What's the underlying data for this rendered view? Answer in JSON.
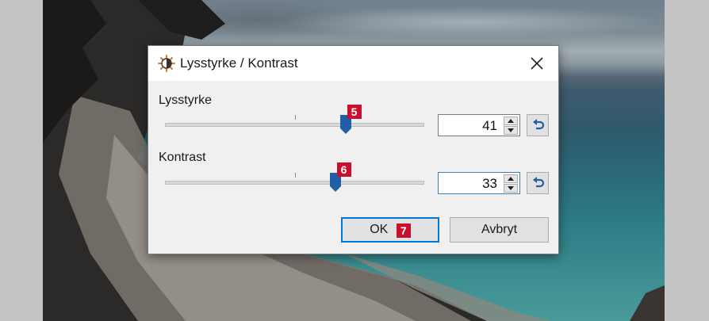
{
  "dialog": {
    "title": "Lysstyrke / Kontrast",
    "icon": "brightness-contrast-icon",
    "close_icon": "close-icon"
  },
  "brightness": {
    "label": "Lysstyrke",
    "value": "41",
    "slider_fraction": 0.7,
    "badge": "5"
  },
  "contrast": {
    "label": "Kontrast",
    "value": "33",
    "slider_fraction": 0.66,
    "badge": "6"
  },
  "buttons": {
    "ok": "OK",
    "ok_badge": "7",
    "cancel": "Avbryt"
  },
  "colors": {
    "accent": "#0078d7",
    "badge": "#c8102e",
    "thumb": "#1f5fa8"
  }
}
